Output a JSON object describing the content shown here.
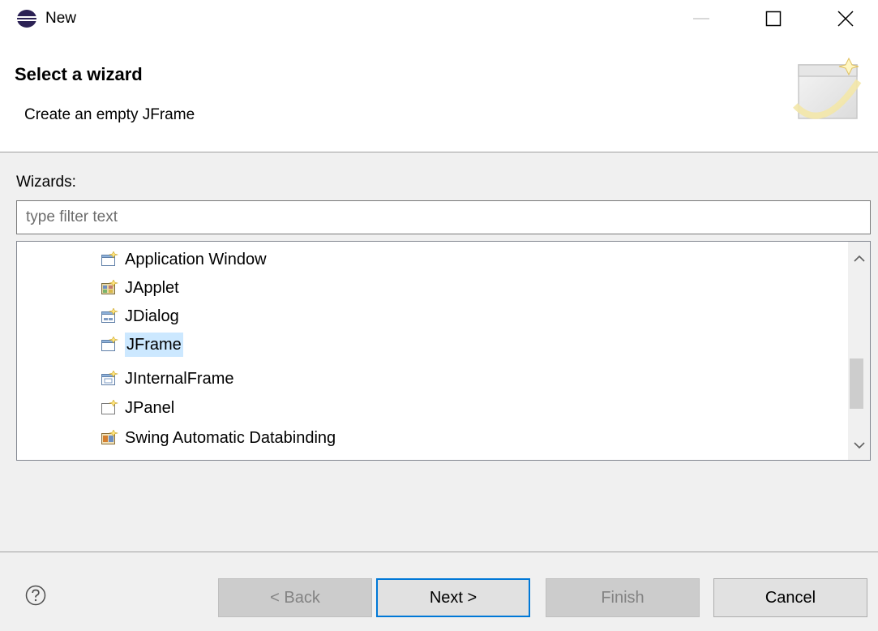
{
  "window": {
    "title": "New"
  },
  "banner": {
    "title": "Select a wizard",
    "description": "Create an empty JFrame"
  },
  "wizards": {
    "label": "Wizards:",
    "filter_placeholder": "type filter text",
    "items": [
      {
        "label": "Application Window",
        "icon": "window-icon",
        "selected": false
      },
      {
        "label": "JApplet",
        "icon": "applet-icon",
        "selected": false
      },
      {
        "label": "JDialog",
        "icon": "dialog-icon",
        "selected": false
      },
      {
        "label": "JFrame",
        "icon": "frame-icon",
        "selected": true
      },
      {
        "label": "JInternalFrame",
        "icon": "internal-frame-icon",
        "selected": false
      },
      {
        "label": "JPanel",
        "icon": "panel-icon",
        "selected": false
      },
      {
        "label": "Swing Automatic Databinding",
        "icon": "databinding-icon",
        "selected": false
      }
    ]
  },
  "buttons": {
    "back": "< Back",
    "next": "Next >",
    "finish": "Finish",
    "cancel": "Cancel"
  },
  "colors": {
    "accent": "#0078d7",
    "selection": "#cce8ff"
  }
}
